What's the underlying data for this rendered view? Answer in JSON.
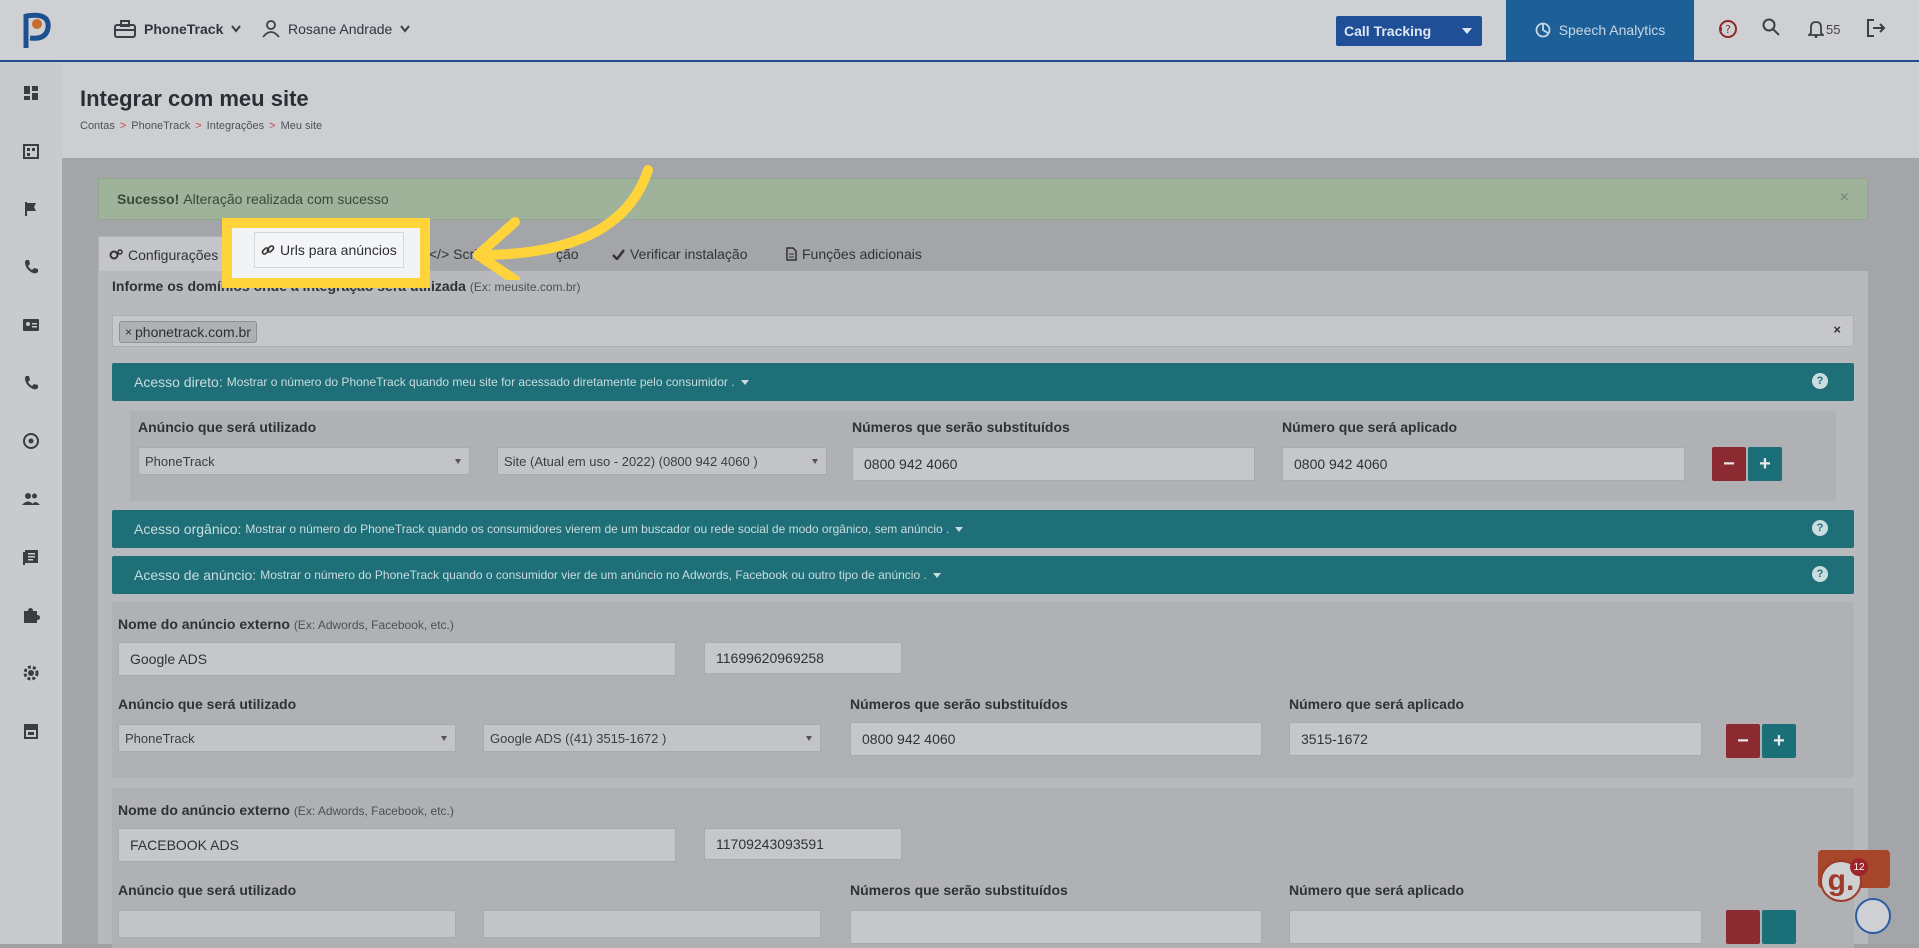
{
  "topbar": {
    "product": "PhoneTrack",
    "user": "Rosane Andrade",
    "call_tracking": "Call Tracking",
    "speech_analytics": "Speech Analytics",
    "notifications_count": "55"
  },
  "header": {
    "title": "Integrar com meu site",
    "breadcrumb": [
      "Contas",
      "PhoneTrack",
      "Integrações",
      "Meu site"
    ]
  },
  "alert": {
    "strong": "Sucesso!",
    "text": "Alteração realizada com sucesso",
    "close": "×"
  },
  "tabs": {
    "configuracoes": "Configurações",
    "urls": "Urls para anúncios",
    "script": "</> Scrip",
    "script_tail": "ção",
    "verificar": "Verificar instalação",
    "funcoes": "Funções adicionais"
  },
  "domains": {
    "label": "Informe os domínios onde a integração será utilizada",
    "hint": "(Ex: meusite.com.br)",
    "tag": "phonetrack.com.br",
    "tag_x": "×",
    "clear": "×"
  },
  "acesso_direto": {
    "head": "Acesso direto:",
    "desc": "Mostrar o número do PhoneTrack quando meu site for acessado diretamente pelo consumidor .",
    "anuncio_label": "Anúncio que será utilizado",
    "anuncio_value": "PhoneTrack",
    "site_value": "Site (Atual em uso - 2022) (0800 942 4060 )",
    "subst_label": "Números que serão substituídos",
    "subst_value": "0800 942 4060",
    "aplicado_label": "Número que será aplicado",
    "aplicado_value": "0800 942 4060"
  },
  "acesso_organico": {
    "head": "Acesso orgânico:",
    "desc": "Mostrar o número do PhoneTrack quando os consumidores vierem de um buscador ou rede social de modo orgânico, sem anúncio ."
  },
  "acesso_anuncio": {
    "head": "Acesso de anúncio:",
    "desc": "Mostrar o número do PhoneTrack quando o consumidor vier de um anúncio no Adwords, Facebook ou outro tipo de anúncio .",
    "nome_label": "Nome do anúncio externo",
    "nome_hint": "(Ex: Adwords, Facebook, etc.)",
    "anuncio_label": "Anúncio que será utilizado",
    "subst_label": "Números que serão substituídos",
    "aplicado_label": "Número que será aplicado",
    "items": [
      {
        "nome": "Google ADS",
        "id": "11699620969258",
        "anuncio": "PhoneTrack",
        "campanha": "Google ADS ((41) 3515-1672 )",
        "subst": "0800 942 4060",
        "aplicado": "3515-1672"
      },
      {
        "nome": "FACEBOOK ADS",
        "id": "11709243093591"
      }
    ]
  },
  "widgets": {
    "g_letter": "g.",
    "g_count": "12"
  }
}
